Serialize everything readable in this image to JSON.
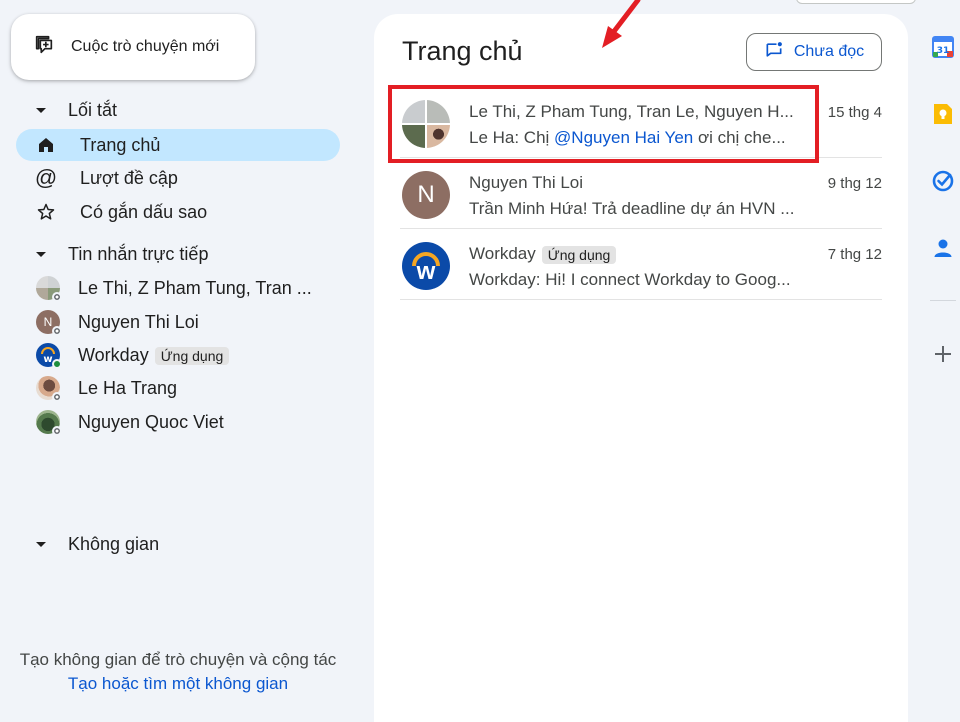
{
  "sidebar": {
    "new_chat_label": "Cuộc trò chuyện mới",
    "shortcuts_label": "Lối tắt",
    "shortcuts": [
      {
        "label": "Trang chủ",
        "icon": "home-icon",
        "active": true
      },
      {
        "label": "Lượt đề cập",
        "icon": "at-sign-icon",
        "active": false
      },
      {
        "label": "Có gắn dấu sao",
        "icon": "star-icon",
        "active": false
      }
    ],
    "dm_label": "Tin nhắn trực tiếp",
    "dms": [
      {
        "label": "Le Thi, Z Pham Tung, Tran ..."
      },
      {
        "label": "Nguyen Thi Loi"
      },
      {
        "label": "Workday",
        "chip": "Ứng dụng"
      },
      {
        "label": "Le Ha Trang"
      },
      {
        "label": "Nguyen Quoc Viet"
      }
    ],
    "spaces_label": "Không gian",
    "empty_spaces_text": "Tạo không gian để trò chuyện và cộng tác",
    "empty_spaces_link": "Tạo hoặc tìm một không gian"
  },
  "main": {
    "title": "Trang chủ",
    "unread_label": "Chưa đọc",
    "conversations": [
      {
        "name": "Le Thi, Z Pham Tung, Tran Le, Nguyen H...",
        "snippet_prefix": "Le Ha: Chị ",
        "snippet_mention": "@Nguyen Hai Yen",
        "snippet_suffix": " ơi chị che...",
        "date": "15 thg 4"
      },
      {
        "name": "Nguyen Thi Loi",
        "avatar_letter": "N",
        "snippet": "Trần Minh Hứa! Trả deadline dự án HVN ...",
        "date": "9 thg 12"
      },
      {
        "name": "Workday",
        "chip": "Ứng dụng",
        "avatar_letter": "w",
        "snippet": "Workday: Hi! I connect Workday to Goog...",
        "date": "7 thg 12"
      }
    ]
  },
  "rail": {
    "calendar_day": "31",
    "icons": [
      "calendar-icon",
      "keep-icon",
      "tasks-icon",
      "contacts-icon",
      "add-icon"
    ]
  },
  "colors": {
    "accent": "#0b57d0",
    "active_nav": "#c2e7ff",
    "highlight": "#e31e24",
    "background": "#f1f4f9"
  }
}
